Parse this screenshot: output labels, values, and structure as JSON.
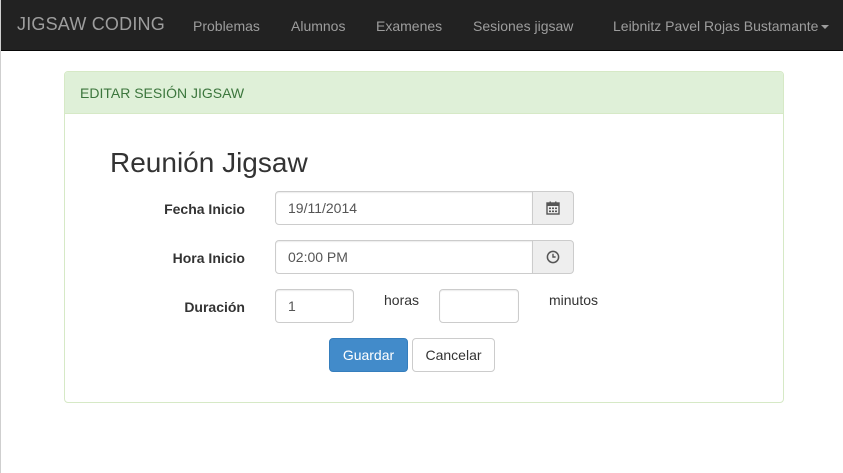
{
  "navbar": {
    "brand": "JIGSAW CODING",
    "links": [
      "Problemas",
      "Alumnos",
      "Examenes",
      "Sesiones jigsaw"
    ],
    "user_menu": "Leibnitz Pavel Rojas Bustamante"
  },
  "panel": {
    "heading": "EDITAR SESIÓN JIGSAW"
  },
  "form": {
    "title": "Reunión Jigsaw",
    "fecha_label": "Fecha Inicio",
    "fecha_value": "19/11/2014",
    "hora_label": "Hora Inicio",
    "hora_value": "02:00 PM",
    "duracion_label": "Duración",
    "duracion_horas_value": "1",
    "horas_unit": "horas",
    "duracion_minutos_value": "",
    "minutos_unit": "minutos",
    "save_label": "Guardar",
    "cancel_label": "Cancelar"
  },
  "icons": {
    "calendar": "calendar-icon",
    "clock": "clock-icon",
    "dropdown": "caret-down-icon"
  },
  "colors": {
    "navbar_bg": "#222222",
    "panel_heading_bg": "#dff0d8",
    "panel_heading_text": "#3c763d",
    "primary": "#428bca"
  }
}
